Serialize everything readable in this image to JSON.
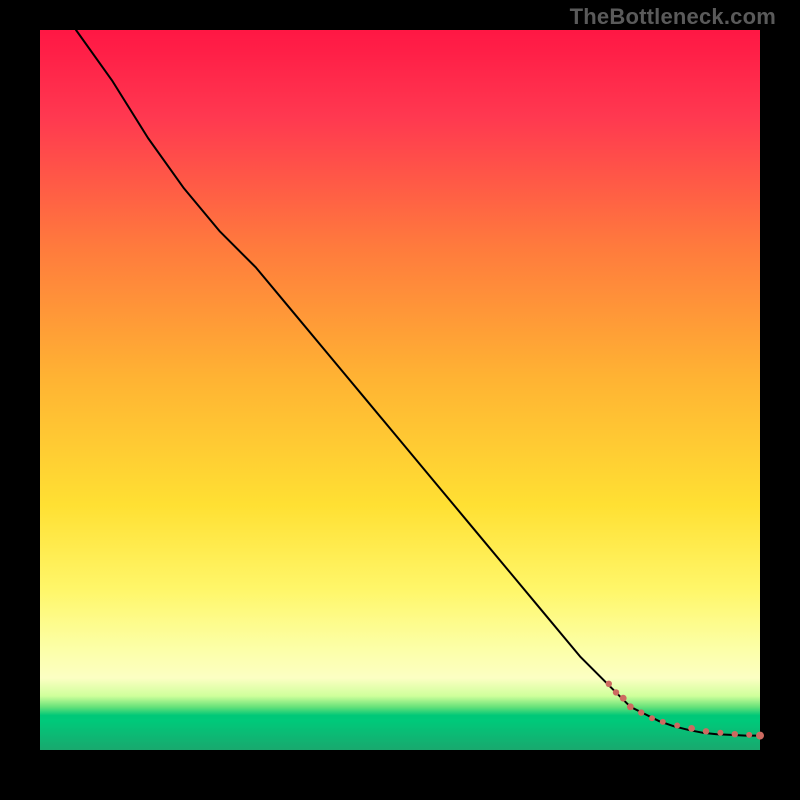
{
  "watermark": "TheBottleneck.com",
  "chart_data": {
    "type": "line",
    "title": "",
    "xlabel": "",
    "ylabel": "",
    "xlim": [
      0,
      100
    ],
    "ylim": [
      0,
      100
    ],
    "grid": false,
    "legend": false,
    "series": [
      {
        "name": "curve",
        "x": [
          5,
          10,
          15,
          20,
          25,
          30,
          35,
          40,
          45,
          50,
          55,
          60,
          65,
          70,
          75,
          80,
          82,
          84,
          86,
          88,
          90,
          92,
          94,
          96,
          98,
          100
        ],
        "y": [
          100,
          93,
          85,
          78,
          72,
          67,
          61,
          55,
          49,
          43,
          37,
          31,
          25,
          19,
          13,
          8,
          6,
          5,
          4,
          3.3,
          2.8,
          2.4,
          2.2,
          2.1,
          2.0,
          2.0
        ]
      }
    ],
    "markers": {
      "name": "tail-dots",
      "color": "#cc6a60",
      "x": [
        79,
        80,
        81,
        82,
        83.5,
        85,
        86.5,
        88.5,
        90.5,
        92.5,
        94.5,
        96.5,
        98.5,
        100
      ],
      "y": [
        9.2,
        8.0,
        7.2,
        6.0,
        5.2,
        4.4,
        3.9,
        3.4,
        3.0,
        2.6,
        2.4,
        2.2,
        2.1,
        2.0
      ],
      "r": [
        3.2,
        3.2,
        3.4,
        3.4,
        3.2,
        3.0,
        3.0,
        3.0,
        3.4,
        3.2,
        3.0,
        3.2,
        3.0,
        4.0
      ]
    },
    "gradient_stops": [
      {
        "pos": 0.0,
        "color": "#ff1744"
      },
      {
        "pos": 0.12,
        "color": "#ff3850"
      },
      {
        "pos": 0.3,
        "color": "#ff7a3d"
      },
      {
        "pos": 0.48,
        "color": "#ffb233"
      },
      {
        "pos": 0.66,
        "color": "#ffe033"
      },
      {
        "pos": 0.78,
        "color": "#fff76b"
      },
      {
        "pos": 0.86,
        "color": "#fcffa8"
      },
      {
        "pos": 0.9,
        "color": "#fcffc3"
      },
      {
        "pos": 0.925,
        "color": "#cfff9b"
      },
      {
        "pos": 0.94,
        "color": "#68e27a"
      },
      {
        "pos": 0.952,
        "color": "#00c878"
      },
      {
        "pos": 0.96,
        "color": "#00c97a"
      },
      {
        "pos": 1.0,
        "color": "#19a86e"
      }
    ]
  }
}
